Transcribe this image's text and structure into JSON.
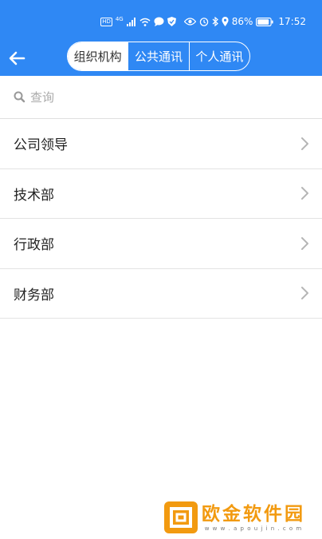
{
  "status_bar": {
    "hd_badge": "HD",
    "network": "4G",
    "battery": "86%",
    "time": "17:52",
    "icons": [
      "hd-icon",
      "signal-icon",
      "wifi-icon",
      "message-icon",
      "shield-icon",
      "eye-icon",
      "alarm-icon",
      "bluetooth-icon",
      "location-icon",
      "battery-icon"
    ]
  },
  "nav": {
    "tabs": [
      {
        "label": "组织机构",
        "active": true
      },
      {
        "label": "公共通讯",
        "active": false
      },
      {
        "label": "个人通讯",
        "active": false
      }
    ]
  },
  "search": {
    "placeholder": "查询",
    "value": ""
  },
  "departments": [
    {
      "label": "公司领导"
    },
    {
      "label": "技术部"
    },
    {
      "label": "行政部"
    },
    {
      "label": "财务部"
    }
  ],
  "watermark": {
    "title": "欧金软件园",
    "url": "w w w . a p o u j i n . c o m"
  },
  "colors": {
    "primary": "#2f88f4",
    "watermark": "#f29a10"
  }
}
